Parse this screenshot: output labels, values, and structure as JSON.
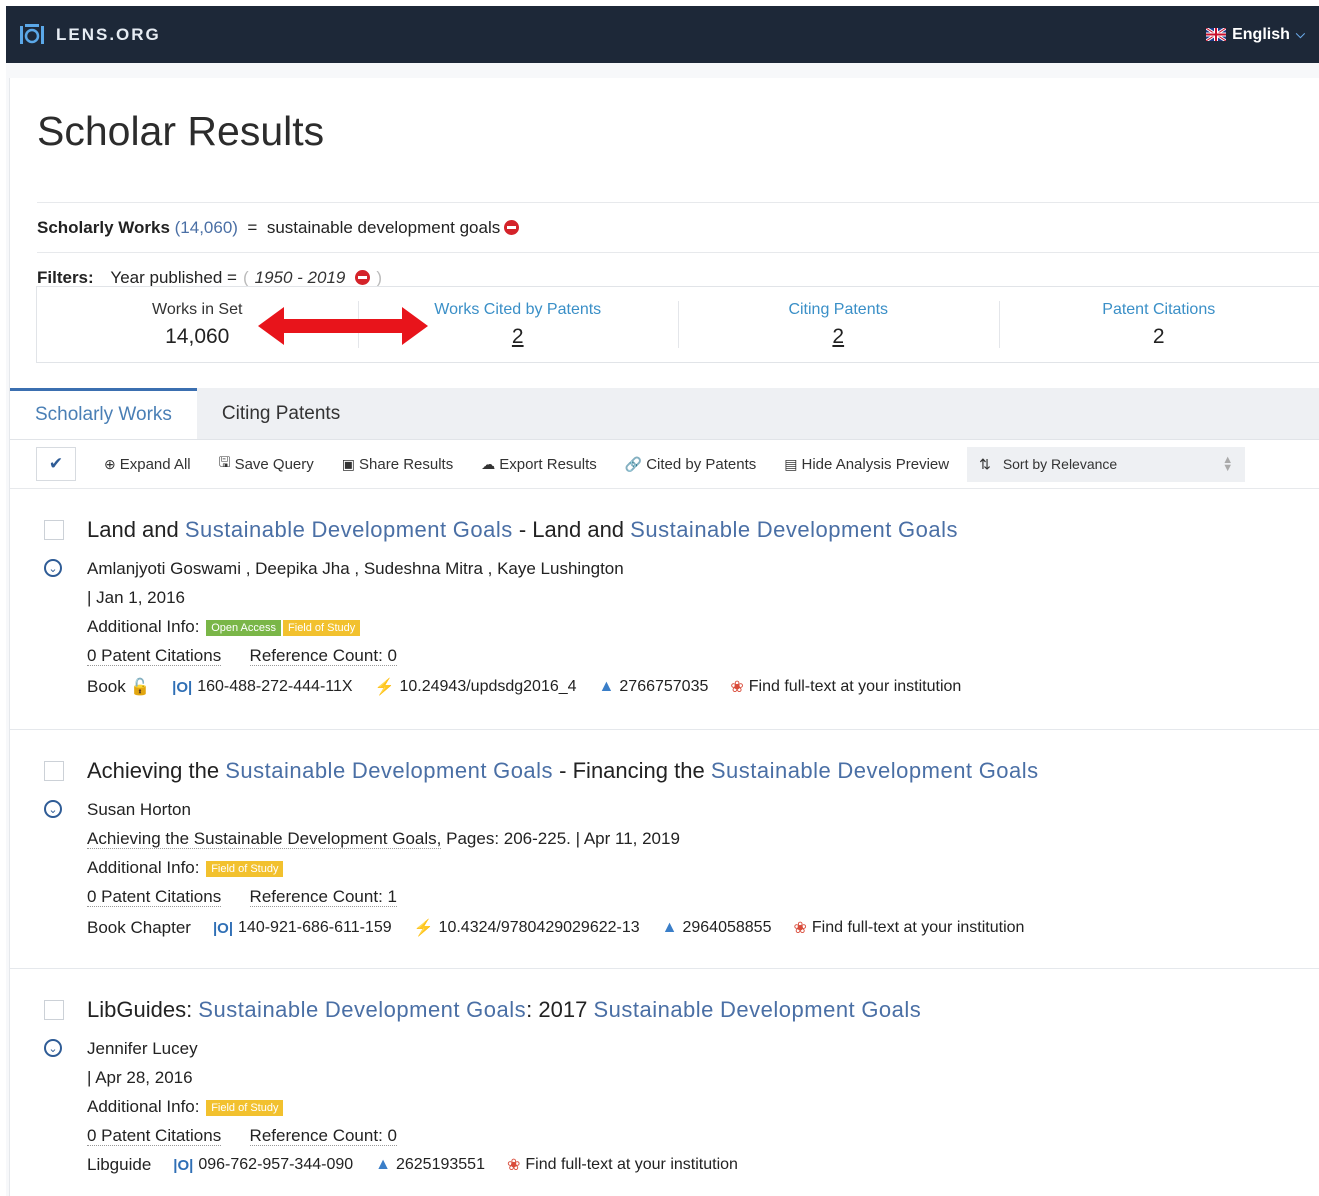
{
  "header": {
    "brand": "LENS.ORG",
    "language": "English"
  },
  "page_title": "Scholar Results",
  "query": {
    "label": "Scholarly Works",
    "count": "(14,060)",
    "equals": "=",
    "value": "sustainable development goals"
  },
  "filters": {
    "label": "Filters:",
    "field": "Year published =",
    "open": "(",
    "value": "1950 - 2019",
    "close": ")"
  },
  "stats": [
    {
      "label": "Works in Set",
      "value": "14,060"
    },
    {
      "label": "Works Cited by Patents",
      "value": "2"
    },
    {
      "label": "Citing Patents",
      "value": "2"
    },
    {
      "label": "Patent Citations",
      "value": "2"
    }
  ],
  "tabs": [
    "Scholarly Works",
    "Citing Patents"
  ],
  "toolbar": {
    "expand_all": "Expand All",
    "save_query": "Save Query",
    "share_results": "Share Results",
    "export_results": "Export Results",
    "cited_by_patents": "Cited by Patents",
    "hide_analysis": "Hide Analysis Preview",
    "sort": "Sort by Relevance"
  },
  "results": [
    {
      "title_parts": [
        "Land and ",
        "Sustainable",
        "Development",
        "Goals",
        " - Land and ",
        "Sustainable",
        "Development",
        "Goals"
      ],
      "authors": "Amlanjyoti Goswami , Deepika Jha , Sudeshna Mitra , Kaye Lushington",
      "source": "",
      "date": "| Jan 1, 2016",
      "info_label": "Additional Info:",
      "open_access": "Open Access",
      "field_of_study": "Field of Study",
      "patent_citations": "0 Patent Citations",
      "reference_count": "Reference Count: 0",
      "type": "Book",
      "lens_id": "160-488-272-444-11X",
      "doi": "10.24943/updsdg2016_4",
      "mag_id": "2766757035",
      "fulltext": "Find full-text at your institution"
    },
    {
      "title_parts": [
        "Achieving the ",
        "Sustainable",
        "Development",
        "Goals",
        " - Financing the ",
        "Sustainable",
        "Development",
        "Goals"
      ],
      "authors": "Susan Horton",
      "source": "Achieving the Sustainable Development Goals,",
      "pages": "Pages: 206-225.",
      "date": "| Apr 11, 2019",
      "info_label": "Additional Info:",
      "field_of_study": "Field of Study",
      "patent_citations": "0 Patent Citations",
      "reference_count": "Reference Count: 1",
      "type": "Book Chapter",
      "lens_id": "140-921-686-611-159",
      "doi": "10.4324/9780429029622-13",
      "mag_id": "2964058855",
      "fulltext": "Find full-text at your institution"
    },
    {
      "title_parts": [
        "LibGuides: ",
        "Sustainable",
        "Development",
        "Goals",
        ": 2017 ",
        "Sustainable",
        "Development",
        "Goals"
      ],
      "authors": "Jennifer Lucey",
      "date": "| Apr 28, 2016",
      "info_label": "Additional Info:",
      "field_of_study": "Field of Study",
      "patent_citations": "0 Patent Citations",
      "reference_count": "Reference Count: 0",
      "type": "Libguide",
      "lens_id": "096-762-957-344-090",
      "mag_id": "2625193551",
      "fulltext": "Find full-text at your institution"
    }
  ],
  "colors": {
    "topbar": "#1d2838",
    "link": "#4a6fa5",
    "accent_tab": "#3b6fb0",
    "remove": "#d4232a",
    "arrow": "#e8141b",
    "open_access": "#7ab648",
    "field_of_study": "#f2c12e"
  }
}
